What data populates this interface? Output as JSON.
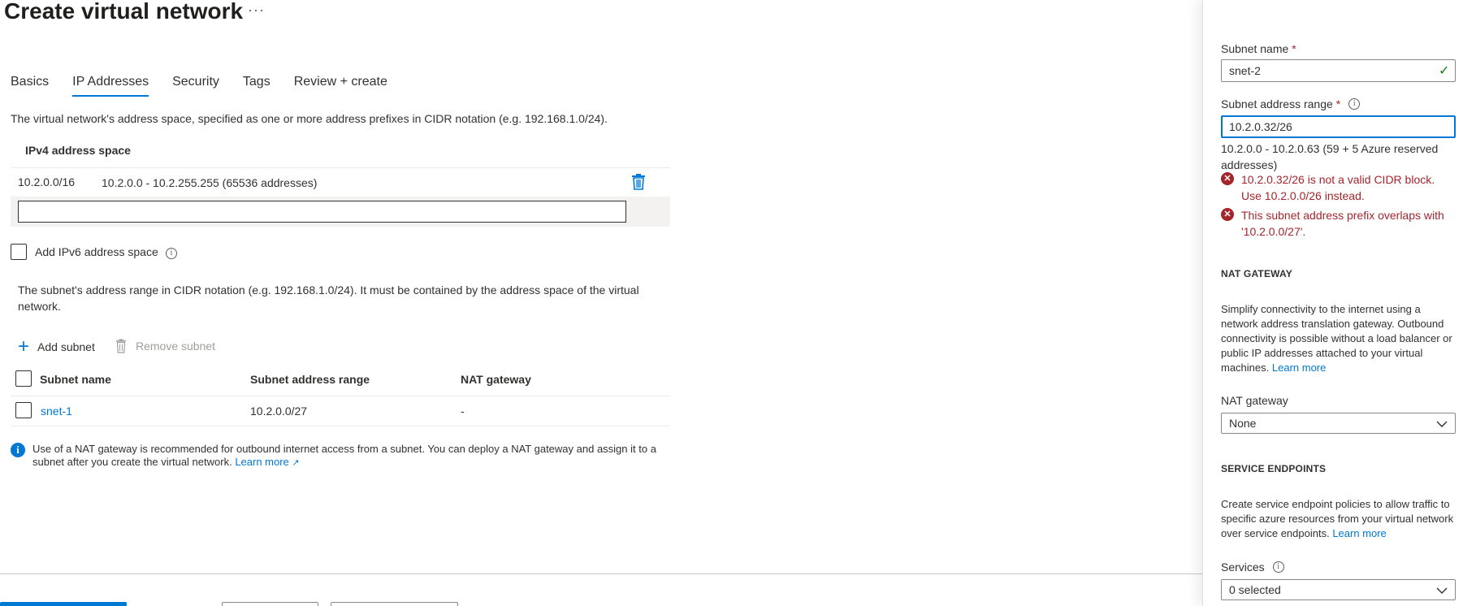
{
  "page": {
    "title": "Create virtual network",
    "more_label": "···"
  },
  "tabs": [
    {
      "label": "Basics"
    },
    {
      "label": "IP Addresses"
    },
    {
      "label": "Security"
    },
    {
      "label": "Tags"
    },
    {
      "label": "Review + create"
    }
  ],
  "address_space": {
    "description": "The virtual network's address space, specified as one or more address prefixes in CIDR notation (e.g. 192.168.1.0/24).",
    "ipv4_header": "IPv4 address space",
    "rows": [
      {
        "prefix": "10.2.0.0/16",
        "range": "10.2.0.0 - 10.2.255.255 (65536 addresses)"
      }
    ],
    "new_value": ""
  },
  "ipv6": {
    "label": "Add IPv6 address space",
    "checked": false
  },
  "subnets": {
    "description": "The subnet's address range in CIDR notation (e.g. 192.168.1.0/24). It must be contained by the address space of the virtual network.",
    "add_label": "Add subnet",
    "remove_label": "Remove subnet",
    "columns": [
      "Subnet name",
      "Subnet address range",
      "NAT gateway"
    ],
    "rows": [
      {
        "name": "snet-1",
        "range": "10.2.0.0/27",
        "nat": "-"
      }
    ]
  },
  "info_banner": {
    "text": "Use of a NAT gateway is recommended for outbound internet access from a subnet. You can deploy a NAT gateway and assign it to a subnet after you create the virtual network.",
    "link": "Learn more",
    "link_icon": "↗"
  },
  "panel": {
    "subnet_name_label": "Subnet name",
    "required_mark": "*",
    "subnet_name_value": "snet-2",
    "subnet_range_label": "Subnet address range",
    "subnet_range_value": "10.2.0.32/26",
    "subnet_range_hint": "10.2.0.0 - 10.2.0.63 (59 + 5 Azure reserved addresses)",
    "errors": [
      "10.2.0.32/26 is not a valid CIDR block. Use 10.2.0.0/26 instead.",
      "This subnet address prefix overlaps with '10.2.0.0/27'."
    ],
    "nat_section": "NAT GATEWAY",
    "nat_desc": "Simplify connectivity to the internet using a network address translation gateway. Outbound connectivity is possible without a load balancer or public IP addresses attached to your virtual machines.",
    "nat_learn_more": "Learn more",
    "nat_gateway_label": "NAT gateway",
    "nat_gateway_value": "None",
    "service_section": "SERVICE ENDPOINTS",
    "service_desc": "Create service endpoint policies to allow traffic to specific azure resources from your virtual network over service endpoints.",
    "service_learn_more": "Learn more",
    "services_label": "Services",
    "services_value": "0 selected"
  },
  "colors": {
    "accent": "#0078d4",
    "error": "#a4262c",
    "success": "#107c10"
  }
}
